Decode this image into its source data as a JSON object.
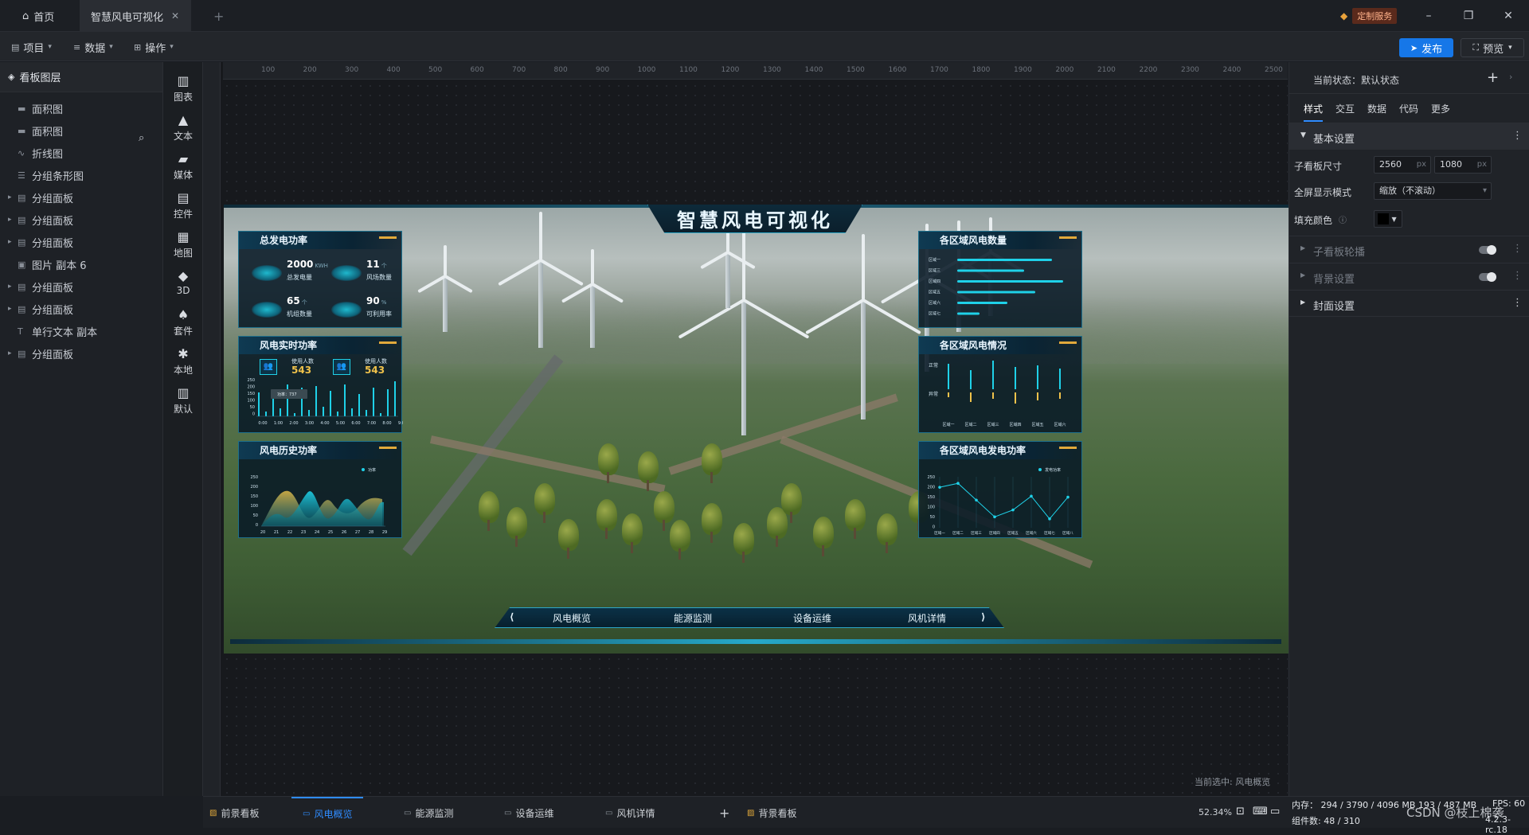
{
  "titlebar": {
    "home_tab": "首页",
    "active_tab": "智慧风电可视化",
    "add_tab": "+",
    "custom_service": "定制服务"
  },
  "toolbar": {
    "menus": [
      "项目",
      "数据",
      "操作"
    ],
    "publish": "发布",
    "preview": "预览"
  },
  "layers": {
    "title": "看板图层",
    "items": [
      {
        "label": "面积图",
        "icon": "area-chart-icon",
        "group": false
      },
      {
        "label": "面积图",
        "icon": "area-chart-icon",
        "group": false
      },
      {
        "label": "折线图",
        "icon": "line-chart-icon",
        "group": false
      },
      {
        "label": "分组条形图",
        "icon": "bar-chart-icon",
        "group": false
      },
      {
        "label": "分组面板",
        "icon": "panel-icon",
        "group": true
      },
      {
        "label": "分组面板",
        "icon": "panel-icon",
        "group": true
      },
      {
        "label": "分组面板",
        "icon": "panel-icon",
        "group": true
      },
      {
        "label": "图片 副本 6",
        "icon": "image-icon",
        "group": false
      },
      {
        "label": "分组面板",
        "icon": "panel-icon",
        "group": true
      },
      {
        "label": "分组面板",
        "icon": "panel-icon",
        "group": true
      },
      {
        "label": "单行文本 副本",
        "icon": "text-icon",
        "group": false
      },
      {
        "label": "分组面板",
        "icon": "panel-icon",
        "group": true
      }
    ]
  },
  "strip": [
    "图表",
    "文本",
    "媒体",
    "控件",
    "地图",
    "3D",
    "套件",
    "本地",
    "默认"
  ],
  "ruler": [
    "100",
    "200",
    "300",
    "400",
    "500",
    "600",
    "700",
    "800",
    "900",
    "1000",
    "1100",
    "1200",
    "1300",
    "1400",
    "1500",
    "1600",
    "1700",
    "1800",
    "1900",
    "2000",
    "2100",
    "2200",
    "2300",
    "2400",
    "2500"
  ],
  "dashboard": {
    "title": "智慧风电可视化",
    "panel1": {
      "title": "总发电功率",
      "stats": [
        {
          "value": "2000",
          "unit": "KWH",
          "label": "总发电量"
        },
        {
          "value": "11",
          "unit": "个",
          "label": "风场数量"
        },
        {
          "value": "65",
          "unit": "个",
          "label": "机组数量"
        },
        {
          "value": "90",
          "unit": "%",
          "label": "可利用率"
        }
      ]
    },
    "panel2": {
      "title": "风电实时功率",
      "users": [
        {
          "label": "使用人数",
          "value": "543"
        },
        {
          "label": "使用人数",
          "value": "543"
        }
      ],
      "tooltip": "功率：737",
      "yticks": [
        "250",
        "200",
        "150",
        "100",
        "50",
        "0"
      ],
      "xticks": [
        "0:00",
        "1:00",
        "2:00",
        "3:00",
        "4:00",
        "5:00",
        "6:00",
        "7:00",
        "8:00",
        "9:00"
      ]
    },
    "panel3": {
      "title": "风电历史功率",
      "legend": "功率",
      "yticks": [
        "250",
        "200",
        "150",
        "100",
        "50",
        "0"
      ],
      "xticks": [
        "20",
        "21",
        "22",
        "23",
        "24",
        "25",
        "26",
        "27",
        "28",
        "29"
      ]
    },
    "panel4": {
      "title": "各区域风电数量",
      "regions": [
        "区域一",
        "区域三",
        "区域四",
        "区域五",
        "区域六",
        "区域七"
      ],
      "values": [
        0.85,
        0.6,
        0.95,
        0.7,
        0.45,
        0.2
      ]
    },
    "panel5": {
      "title": "各区域风电情况",
      "row_labels": [
        "正常",
        "异常"
      ],
      "regions": [
        "区域一",
        "区域二",
        "区域三",
        "区域四",
        "区域五",
        "区域六"
      ]
    },
    "panel6": {
      "title": "各区域风电发电功率",
      "legend": "发电功率",
      "yticks": [
        "250",
        "200",
        "150",
        "100",
        "50",
        "0"
      ],
      "regions": [
        "区域一",
        "区域二",
        "区域三",
        "区域四",
        "区域五",
        "区域六",
        "区域七",
        "区域八"
      ],
      "values": [
        205,
        225,
        140,
        55,
        90,
        160,
        45,
        155
      ]
    },
    "nav": [
      "风电概览",
      "能源监测",
      "设备运维",
      "风机详情"
    ]
  },
  "canvas": {
    "current_selection": "当前选中: 风电概览"
  },
  "props": {
    "current_state": "当前状态：默认状态",
    "tabs": [
      "样式",
      "交互",
      "数据",
      "代码",
      "更多"
    ],
    "basic_settings": "基本设置",
    "size_label": "子看板尺寸",
    "width": "2560",
    "height": "1080",
    "unit": "px",
    "fullscreen_label": "全屏显示模式",
    "fullscreen_value": "缩放（不滚动）",
    "fill_label": "填充颜色",
    "carousel": "子看板轮播",
    "background": "背景设置",
    "cover": "封面设置"
  },
  "bottombar": {
    "tabs": [
      "前景看板",
      "风电概览",
      "能源监测",
      "设备运维",
      "风机详情"
    ],
    "add": "+",
    "bg_tab": "背景看板",
    "zoom": "52.34%",
    "memory": "内存： 294 / 3790 / 4096 MB  193 / 487 MB",
    "components": "组件数: 48 / 310",
    "fps": "FPS: 60",
    "version": "4.2.3-rc.18",
    "watermark": "CSDN @枝上棉袭"
  },
  "colors": {
    "accent": "#1677e8",
    "panel_border": "#1d6f8c",
    "cyan": "#1fd1e8",
    "gold": "#e2a93b"
  }
}
